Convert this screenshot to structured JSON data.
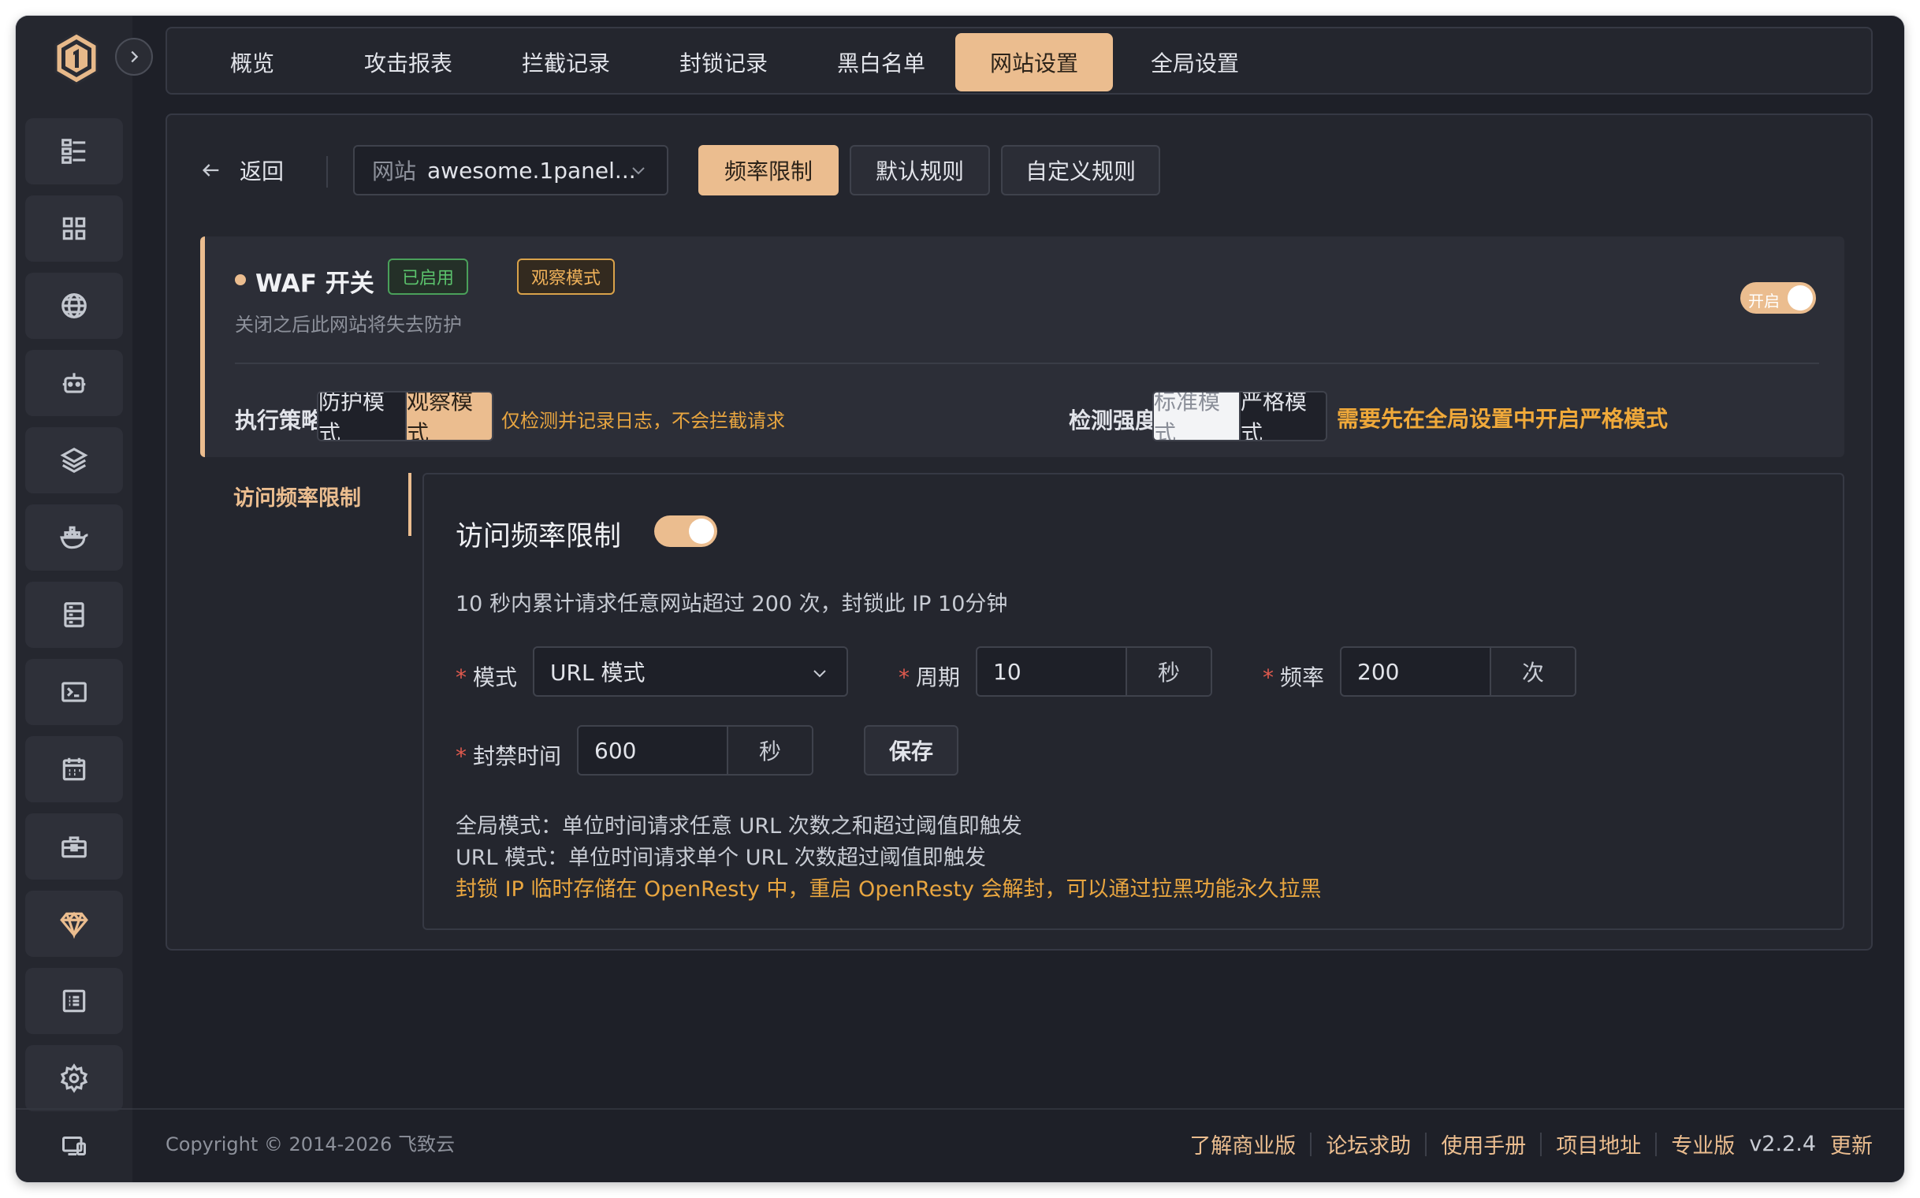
{
  "nav": {
    "tabs": [
      {
        "label": "概览"
      },
      {
        "label": "攻击报表"
      },
      {
        "label": "拦截记录"
      },
      {
        "label": "封锁记录"
      },
      {
        "label": "黑白名单"
      },
      {
        "label": "网站设置",
        "active": true
      },
      {
        "label": "全局设置"
      }
    ]
  },
  "sidebar": {
    "icons": [
      "dashboard-icon",
      "apps-grid-icon",
      "globe-icon",
      "robot-icon",
      "layers-icon",
      "docker-icon",
      "database-icon",
      "terminal-icon",
      "calendar-icon",
      "toolbox-icon",
      "diamond-icon",
      "logs-icon",
      "gear-icon"
    ],
    "bottom_icon": "monitor-icon",
    "collapse_icon": "chevron-right-icon"
  },
  "toolbar": {
    "back_label": "返回",
    "site_prefix": "网站",
    "site_value": "awesome.1panel...",
    "buttons": [
      {
        "label": "频率限制",
        "active": true
      },
      {
        "label": "默认规则"
      },
      {
        "label": "自定义规则"
      }
    ]
  },
  "waf": {
    "title": "WAF 开关",
    "tag_enabled": "已启用",
    "tag_observe": "观察模式",
    "description": "关闭之后此网站将失去防护",
    "switch_label": "开启",
    "switch_on": true,
    "strategy_label": "执行策略",
    "strategy_options": [
      "防护模式",
      "观察模式"
    ],
    "strategy_selected": "观察模式",
    "strategy_hint": "仅检测并记录日志，不会拦截请求",
    "strength_label": "检测强度",
    "strength_options": [
      "标准模式",
      "严格模式"
    ],
    "strength_selected": "标准模式",
    "strength_hint": "需要先在全局设置中开启严格模式"
  },
  "subnav": {
    "item": "访问频率限制"
  },
  "rate_limit": {
    "title": "访问频率限制",
    "enabled": true,
    "summary": "10 秒内累计请求任意网站超过 200 次，封锁此 IP 10分钟",
    "mode_label": "模式",
    "mode_value": "URL 模式",
    "period_label": "周期",
    "period_value": "10",
    "period_unit": "秒",
    "freq_label": "频率",
    "freq_value": "200",
    "freq_unit": "次",
    "ban_label": "封禁时间",
    "ban_value": "600",
    "ban_unit": "秒",
    "save_label": "保存",
    "note_global": "全局模式：单位时间请求任意 URL 次数之和超过阈值即触发",
    "note_url": "URL 模式：单位时间请求单个 URL 次数超过阈值即触发",
    "note_warning": "封锁 IP 临时存储在 OpenResty 中，重启 OpenResty 会解封，可以通过拉黑功能永久拉黑"
  },
  "footer": {
    "copyright": "Copyright © 2014-2026 飞致云",
    "links": [
      "了解商业版",
      "论坛求助",
      "使用手册",
      "项目地址",
      "专业版"
    ],
    "version": "v2.2.4",
    "update": "更新"
  },
  "colors": {
    "accent": "#ebbd8f",
    "warning": "#e9a640",
    "success": "#5bc26c",
    "background": "#1e2028"
  }
}
